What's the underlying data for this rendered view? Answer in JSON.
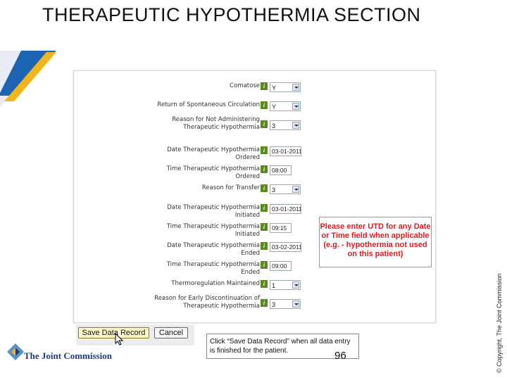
{
  "slide": {
    "title": "THERAPEUTIC HYPOTHERMIA SECTION",
    "copyright": "© Copyright, The Joint Commission",
    "slide_number": "96",
    "logo_text": "The Joint Commission"
  },
  "form": {
    "help_glyph": "i",
    "rows": [
      {
        "label": "Comatose",
        "control": "select",
        "value": "Y"
      },
      {
        "label": "Return of Spontaneous Circulation",
        "control": "select",
        "value": "Y"
      },
      {
        "label": "Reason for Not Administering Therapeutic Hypothermia",
        "control": "select",
        "value": "3"
      },
      {
        "label": "Date Therapeutic Hypothermia Ordered",
        "control": "date",
        "value": "03-01-2011"
      },
      {
        "label": "Time Therapeutic Hypothermia Ordered",
        "control": "time",
        "value": "08:00"
      },
      {
        "label": "Reason for Transfer",
        "control": "select",
        "value": "3"
      },
      {
        "label": "Date Therapeutic Hypothermia Initiated",
        "control": "date",
        "value": "03-01-2011"
      },
      {
        "label": "Time Therapeutic Hypothermia Initiated",
        "control": "time",
        "value": "09:15"
      },
      {
        "label": "Date Therapeutic Hypothermia Ended",
        "control": "date",
        "value": "03-02-2011"
      },
      {
        "label": "Time Therapeutic Hypothermia Ended",
        "control": "time",
        "value": "09:00"
      },
      {
        "label": "Thermoregulation Maintained",
        "control": "select",
        "value": "1"
      },
      {
        "label": "Reason for Early Discontinuation of Therapeutic Hypothermia",
        "control": "select",
        "value": "3"
      }
    ],
    "notice": "Please enter UTD for any Date or Time field when applicable (e.g. - hypothermia not used on this patient)",
    "save_label": "Save Data Record",
    "cancel_label": "Cancel"
  },
  "callout": "Click “Save Data Record” when all data entry is finished for the patient.",
  "colors": {
    "help_icon": "#5a8a1c",
    "notice_text": "#e0191e",
    "brand_blue": "#1e3c78",
    "brand_gold": "#f2b61c",
    "brand_light_blue": "#5b8fd0"
  }
}
